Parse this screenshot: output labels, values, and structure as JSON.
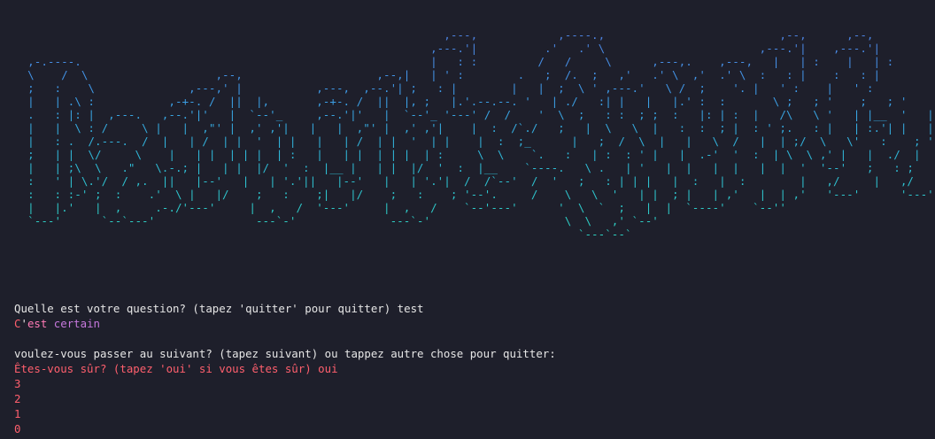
{
  "colors": {
    "background": "#1e1f2b",
    "text": "#e6e6e6",
    "banner_gradient_top": "#4f7fe0",
    "banner_gradient_bottom": "#2dd4bf",
    "answer_c": "#ff5f6d",
    "answer_est": "#ff7ab6",
    "answer_certain": "#c678dd",
    "confirm_text": "#ff5f6d"
  },
  "banner": {
    "ascii": "                                                                ,---,            ,----.,                          ,--,      ,--,\n                                                              ,---.'|          .'   .' \\                       ,---.'|    ,---.'|\n  ,-.----.                                                    |   : :         /   /     \\      ,---,.    ,---,   |   | :    |   | :\n  \\    /  \\                   ,--,                    ,--,|   | ' :        .   ;  /.  ;   ,'   .' \\  ,'  .' \\  :   : |    :   : |\n  ;   :    \\              ,---,' |           ,---,  ,--.'| ;   : |        |   |  ;  \\ ' ,---.'   \\ /  ;    '. |   ' :    |   ' :\n  |   | .\\ :           ,-+-. /  ||  |,       ,-+-. /  ||  |, ;   |.'.--.--. '   | ./   :| |   |   |.' :  :       \\ ;   ; '    ;   ; '\n  .   : |: |  ,---.   ,--.'|'   |  `--'_     ,--.'|'   |  `--'_ '---' /  /    '  \\  ;   : :  ; ;  :   |: | :  |   /\\   \\ '   | |__  '   | |__\n  |   |  \\ : /     \\ |   |  ,\"' |  ,' ,'|   |   |  ,\"' |  ,' ,'|    |  :  /`./   ;   |  \\   \\  |   :  :  ; |  : ' ;.   : |   | :.'| |   | :.'|\n  |   : .  /.---.  /  |   | /  | |  '  | |   |   | /  | |  '  | |    |  :  ;_      |   ;  /  \\  |   |   \\  /   |  | ;/  \\   \\'   :    ; '   :    ;\n  ;   | |  \\/     \\    |   | |  | | |  | :   |   | |  | | |  | :     \\  \\    `.   :   | :  : ' |   |  .-'  '  :  | \\  \\ ,' |   |  ./  |   |  ./\n  |   | ;\\  \\   .\"   \\.-.; |   | |  |/  '  :  |__ |   | |  |/  '  :  |__    `----.   \\ .   | '   |  |   |  |   |  |  '  '--'   ;   : ;    ;   : ;\n  :   ' | \\.'/  / ,.  ||   |--'   |   | '.'||   |--'   |   | '.'|  /  /`--'  /  '   ;   : | | |   |  :   |  :        |   ,/     |   ,/\n  :   : :-' ;  :    .'  \\ |   |/    ;   :    ;|   |/    ;   :    ; '--'.     /    \\   \\  '   | |  ; |   | ,'   |  | ,'   '---'      '---'\n  |   |.'   |  ,     .-./'---'     |  ,   /  '---'     |  ,   /    `--'---'      '  \\  `  ;   |  |  `----'    `--''\n  `---'      `--`---'               ---`-'              ---`-'                    \\  \\   ,' `--'\n                                                                                    `---`--`"
  },
  "output": {
    "prompt_text": "Quelle est votre question? (tapez 'quitter' pour quitter) test",
    "answer_c": "C",
    "answer_apos": "'",
    "answer_est": "est ",
    "answer_certain": "certain",
    "next_prompt": "voulez-vous passer au suivant? (tapez suivant) ou tappez autre chose pour quitter:",
    "confirm_prompt": "Êtes-vous sûr? (tapez 'oui' si vous êtes sûr) oui",
    "countdown": [
      "3",
      "2",
      "1",
      "0"
    ]
  }
}
